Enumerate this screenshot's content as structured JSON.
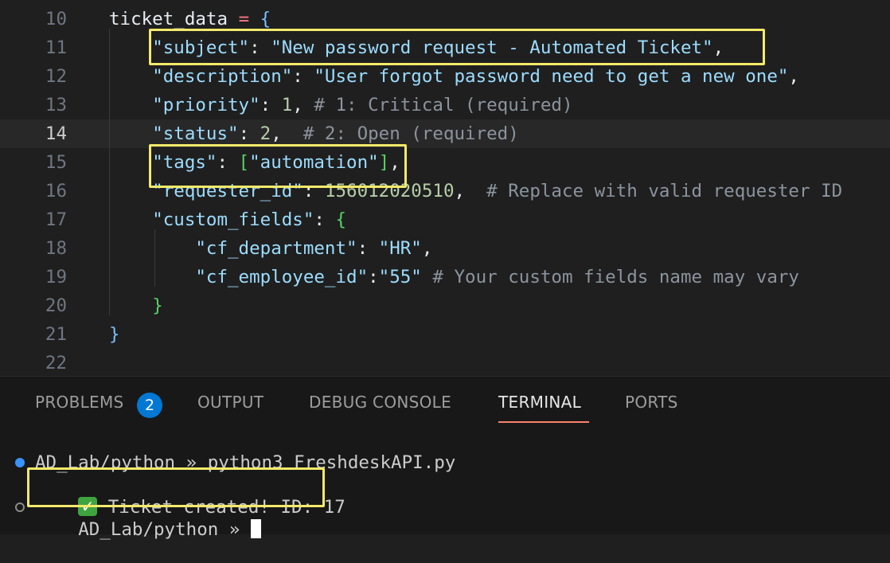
{
  "editor": {
    "lines": [
      {
        "n": "10",
        "parts": [
          {
            "t": "ticket_data ",
            "c": "white"
          },
          {
            "t": "=",
            "c": "op"
          },
          {
            "t": " ",
            "c": "white"
          },
          {
            "t": "{",
            "c": "brace"
          }
        ]
      },
      {
        "n": "11",
        "parts": [
          {
            "t": "    ",
            "c": "white"
          },
          {
            "t": "\"subject\"",
            "c": "key"
          },
          {
            "t": ": ",
            "c": "white"
          },
          {
            "t": "\"New password request - Automated Ticket\"",
            "c": "sval"
          },
          {
            "t": ",",
            "c": "white"
          }
        ]
      },
      {
        "n": "12",
        "parts": [
          {
            "t": "    ",
            "c": "white"
          },
          {
            "t": "\"description\"",
            "c": "key"
          },
          {
            "t": ": ",
            "c": "white"
          },
          {
            "t": "\"User forgot password need to get a new one\"",
            "c": "sval"
          },
          {
            "t": ",",
            "c": "white"
          }
        ]
      },
      {
        "n": "13",
        "parts": [
          {
            "t": "    ",
            "c": "white"
          },
          {
            "t": "\"priority\"",
            "c": "key"
          },
          {
            "t": ": ",
            "c": "white"
          },
          {
            "t": "1",
            "c": "num"
          },
          {
            "t": ", ",
            "c": "white"
          },
          {
            "t": "# 1: Critical (required)",
            "c": "cmt"
          }
        ]
      },
      {
        "n": "14",
        "parts": [
          {
            "t": "    ",
            "c": "white"
          },
          {
            "t": "\"status\"",
            "c": "key"
          },
          {
            "t": ": ",
            "c": "white"
          },
          {
            "t": "2",
            "c": "num"
          },
          {
            "t": ",  ",
            "c": "white"
          },
          {
            "t": "# 2: Open (required)",
            "c": "cmt"
          }
        ]
      },
      {
        "n": "15",
        "parts": [
          {
            "t": "    ",
            "c": "white"
          },
          {
            "t": "\"tags\"",
            "c": "key"
          },
          {
            "t": ": ",
            "c": "white"
          },
          {
            "t": "[",
            "c": "brace2"
          },
          {
            "t": "\"automation\"",
            "c": "sval"
          },
          {
            "t": "]",
            "c": "brace2"
          },
          {
            "t": ",",
            "c": "white"
          }
        ]
      },
      {
        "n": "16",
        "parts": [
          {
            "t": "    ",
            "c": "white"
          },
          {
            "t": "\"requester_id\"",
            "c": "key"
          },
          {
            "t": ": ",
            "c": "white"
          },
          {
            "t": "156012020510",
            "c": "num"
          },
          {
            "t": ",  ",
            "c": "white"
          },
          {
            "t": "# Replace with valid requester ID",
            "c": "cmt"
          }
        ]
      },
      {
        "n": "17",
        "parts": [
          {
            "t": "    ",
            "c": "white"
          },
          {
            "t": "\"custom_fields\"",
            "c": "key"
          },
          {
            "t": ": ",
            "c": "white"
          },
          {
            "t": "{",
            "c": "brace2"
          }
        ]
      },
      {
        "n": "18",
        "parts": [
          {
            "t": "        ",
            "c": "white"
          },
          {
            "t": "\"cf_department\"",
            "c": "key"
          },
          {
            "t": ": ",
            "c": "white"
          },
          {
            "t": "\"HR\"",
            "c": "sval"
          },
          {
            "t": ",",
            "c": "white"
          }
        ]
      },
      {
        "n": "19",
        "parts": [
          {
            "t": "        ",
            "c": "white"
          },
          {
            "t": "\"cf_employee_id\"",
            "c": "key"
          },
          {
            "t": ":",
            "c": "white"
          },
          {
            "t": "\"55\"",
            "c": "sval"
          },
          {
            "t": " ",
            "c": "white"
          },
          {
            "t": "# Your custom fields name may vary",
            "c": "cmt"
          }
        ]
      },
      {
        "n": "20",
        "parts": [
          {
            "t": "    ",
            "c": "white"
          },
          {
            "t": "}",
            "c": "brace2"
          }
        ]
      },
      {
        "n": "21",
        "parts": [
          {
            "t": "}",
            "c": "brace"
          }
        ]
      },
      {
        "n": "22",
        "parts": []
      }
    ],
    "active_line": "14"
  },
  "panel": {
    "tabs": {
      "problems": "PROBLEMS",
      "problems_count": "2",
      "output": "OUTPUT",
      "debug_console": "DEBUG CONSOLE",
      "terminal": "TERMINAL",
      "ports": "PORTS"
    },
    "terminal": {
      "command_line": "AD_Lab/python » python3 FreshdeskAPI.py",
      "output_text": " Ticket created! ID: 17",
      "check_glyph": "✓",
      "prompt_line": "AD_Lab/python » "
    }
  },
  "colors": {
    "highlight_box": "#f4e96a",
    "active_tab_underline": "#f9826c",
    "badge": "#0078d4"
  }
}
